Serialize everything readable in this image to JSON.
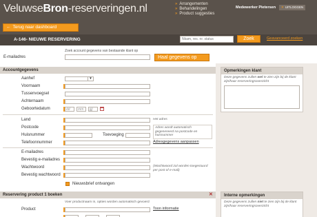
{
  "header": {
    "logo_part1": "Veluwse",
    "logo_part2": "Bron",
    "logo_part3": "-reserveringen.nl",
    "nav": [
      "Arrangementen",
      "Behandelingen",
      "Product suggesties"
    ],
    "user_name": "Medewerker Pietersen",
    "logout_label": "UITLOGGEN"
  },
  "toolbar": {
    "back_label": "Terug naar dashboard",
    "page_title": "A-146- NIEUWE RESERVERING",
    "search_placeholder": "Nkam, res. nr. status",
    "search_button": "Zoek",
    "advanced_link": "Geavanceerd zoeken"
  },
  "lookup": {
    "hint": "Zoek account gegevens van bestaande klant op",
    "email_label": "E-mailadres",
    "button_label": "Haal gegevens op"
  },
  "accountgegevens": {
    "heading": "Accountgegevens",
    "aanhef": "Aanhef",
    "voornaam": "Voornaam",
    "tussenvoegsel": "Tussenvoegsel",
    "achternaam": "Achternaam",
    "geboortedatum": "Geboortedatum",
    "date_dd": "dd",
    "date_mm": "mm",
    "date_jjjj": "jjjj",
    "land": "Land",
    "land_note": "Het adres",
    "postcode": "Postcode",
    "huisnummer": "Huisnummer",
    "toevoeging": "Toevoeging",
    "address_note": "Adres wordt automatisch gegenereerd na postcode en huisnummer",
    "telefoonnummer": "Telefoonnummer",
    "address_link": "Adresgegevens aanpassen",
    "email": "E-mailadres",
    "bevestig_email": "Bevestig e-mailadres",
    "wachtwoord": "Wachtwoord",
    "password_note": "(Wachtwoord zal worden toegestuurd per post of e-mail)",
    "bevestig_wachtwoord": "Bevestig wachtwoord",
    "nieuwsbrief": "Nieuwsbrief ontvangen"
  },
  "reservering": {
    "heading": "Reservering product 1 boeken",
    "hint": "Voer productnaam in, opties worden automatisch gevoerd",
    "product_label": "Product",
    "info_link": "Toon informatie"
  },
  "opmerkingen_klant": {
    "heading": "Opmerkingen klant",
    "note_prefix": "Deze gegevens zullen ",
    "note_em": "wel",
    "note_suffix": " te zien zijn bij de klant zijn/haar reserveringsoverzicht"
  },
  "interne_opmerkingen": {
    "heading": "Interne opmerkingen",
    "note_prefix": "Deze gegevens zullen ",
    "note_em": "niet",
    "note_suffix": " te zien zijn bij de klant zijn/haar reserveringsoverzicht"
  },
  "colors": {
    "accent": "#f39a1e",
    "header_bg": "#5a524b",
    "titlebar_bg": "#4b443e",
    "section_bg": "#d9d3cc"
  }
}
